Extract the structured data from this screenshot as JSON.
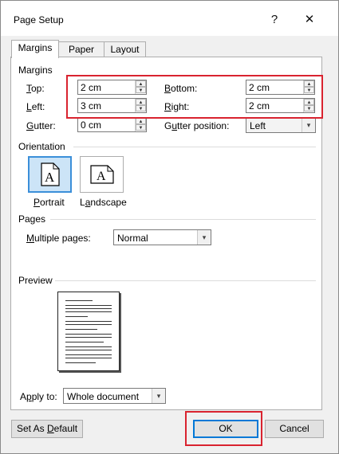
{
  "window": {
    "title": "Page Setup",
    "help_glyph": "?",
    "close_glyph": "✕"
  },
  "tabs": [
    "Margins",
    "Paper",
    "Layout"
  ],
  "margins": {
    "section_label": "Margins",
    "top_label": "Top:",
    "top_value": "2 cm",
    "bottom_label": "Bottom:",
    "bottom_value": "2 cm",
    "left_label": "Left:",
    "left_value": "3 cm",
    "right_label": "Right:",
    "right_value": "2 cm",
    "gutter_label": "Gutter:",
    "gutter_value": "0 cm",
    "gutter_position_label": "Gutter position:",
    "gutter_position_value": "Left"
  },
  "orientation": {
    "section_label": "Orientation",
    "portrait_label": "Portrait",
    "landscape_label": "Landscape",
    "icon_letter": "A",
    "selected": "Portrait"
  },
  "pages": {
    "section_label": "Pages",
    "multiple_pages_label": "Multiple pages:",
    "multiple_pages_value": "Normal"
  },
  "preview": {
    "section_label": "Preview"
  },
  "apply": {
    "label": "Apply to:",
    "value": "Whole document"
  },
  "buttons": {
    "set_default": "Set As Default",
    "ok": "OK",
    "cancel": "Cancel"
  },
  "colors": {
    "highlight": "#d9232f",
    "selected_border": "#3b8fd9",
    "default_button": "#0078d7"
  },
  "icons": [
    "question-icon",
    "close-icon",
    "spin-up-icon",
    "spin-down-icon",
    "dropdown-arrow-icon",
    "portrait-page-icon",
    "landscape-page-icon"
  ]
}
